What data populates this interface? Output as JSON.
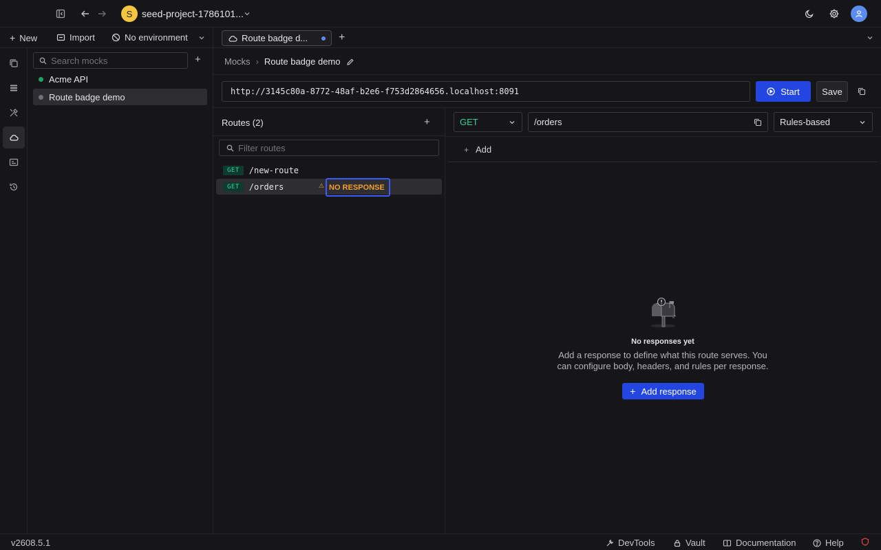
{
  "titlebar": {
    "project_initial": "S",
    "project_name": "seed-project-1786101..."
  },
  "toolbar": {
    "new_label": "New",
    "import_label": "Import",
    "environment_label": "No environment"
  },
  "tabs": [
    {
      "label": "Route badge d...",
      "unsaved": true
    }
  ],
  "sidebar": {
    "search_placeholder": "Search mocks",
    "mocks": [
      {
        "name": "Acme API",
        "status_color": "#22a06b"
      },
      {
        "name": "Route badge demo",
        "status_color": "#71717a"
      }
    ]
  },
  "breadcrumb": {
    "root": "Mocks",
    "separator": "›",
    "current": "Route badge demo"
  },
  "server": {
    "url": "http://3145c80a-8772-48af-b2e6-f753d2864656.localhost:8091",
    "start_label": "Start",
    "save_label": "Save"
  },
  "routes": {
    "title": "Routes (2)",
    "filter_placeholder": "Filter routes",
    "items": [
      {
        "method": "GET",
        "path": "/new-route"
      },
      {
        "method": "GET",
        "path": "/orders",
        "badge": "NO RESPONSE",
        "warn_icon": "⚠"
      }
    ]
  },
  "detail": {
    "method": "GET",
    "path": "/orders",
    "mode": "Rules-based",
    "add_label": "Add",
    "empty_title": "No responses yet",
    "empty_desc_line1": "Add a response to define what this route serves. You",
    "empty_desc_line2": "can configure body, headers, and rules per response.",
    "add_response_label": "Add response"
  },
  "statusbar": {
    "version": "v2608.5.1",
    "devtools_label": "DevTools",
    "vault_label": "Vault",
    "docs_label": "Documentation",
    "help_label": "Help"
  },
  "colors": {
    "accent": "#2346e0",
    "get_method": "#34d399",
    "warning": "#f0a030",
    "highlight_outline": "#3b5bff"
  }
}
